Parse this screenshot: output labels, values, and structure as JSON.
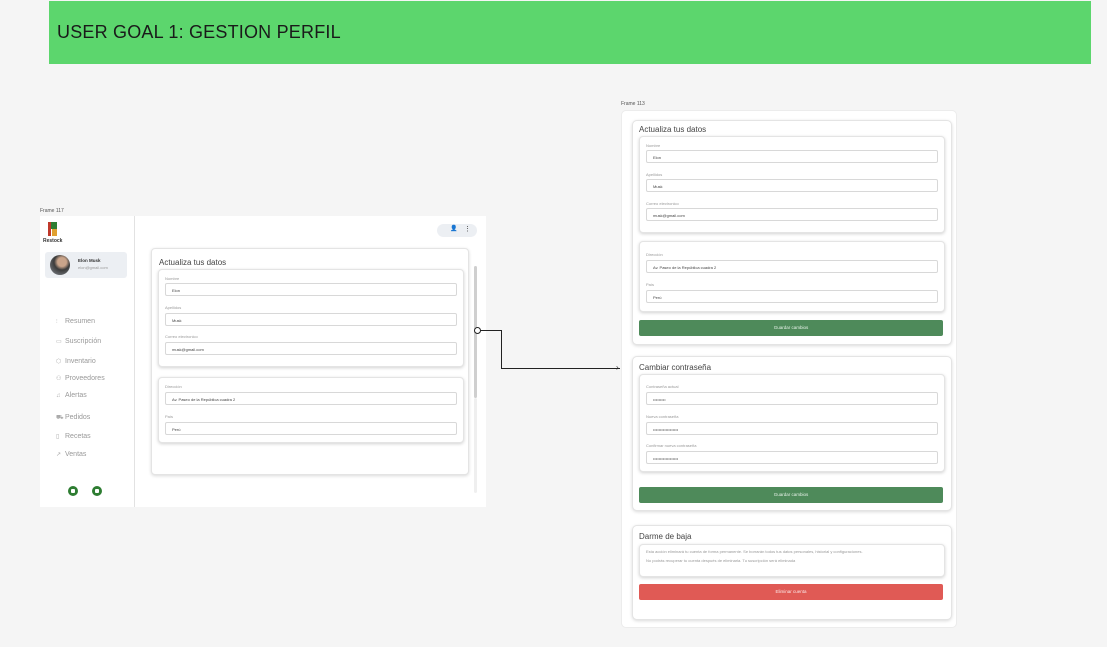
{
  "banner": {
    "title": "USER GOAL 1: GESTION PERFIL"
  },
  "frame_left": {
    "label": "Frame 117",
    "logo_text": "Restock",
    "user": {
      "name": "Elon Musk",
      "email": "elon@gmail.com"
    },
    "nav": [
      {
        "icon": "chart-icon",
        "glyph": "⫶",
        "label": "Resumen"
      },
      {
        "icon": "card-icon",
        "glyph": "▭",
        "label": "Suscripción"
      },
      {
        "icon": "box-icon",
        "glyph": "⬡",
        "label": "Inventario"
      },
      {
        "icon": "people-icon",
        "glyph": "⚇",
        "label": "Proveedores"
      },
      {
        "icon": "bell-icon",
        "glyph": "♫",
        "label": "Alertas"
      },
      {
        "icon": "truck-icon",
        "glyph": "⛟",
        "label": "Pedidos"
      },
      {
        "icon": "recipe-icon",
        "glyph": "▯",
        "label": "Recetas"
      },
      {
        "icon": "trend-icon",
        "glyph": "↗",
        "label": "Ventas"
      }
    ],
    "top_pill": {
      "user_glyph": "👤",
      "menu_glyph": "⋮"
    },
    "panel": {
      "title": "Actualiza tus datos",
      "fields1": [
        {
          "label": "Nombre",
          "value": "Elon"
        },
        {
          "label": "Apellidos",
          "value": "Musk"
        },
        {
          "label": "Correo electronico",
          "value": "musk@gmail.com"
        }
      ],
      "fields2": [
        {
          "label": "Dirección",
          "value": "Av. Paseo de la República cuadra 2"
        },
        {
          "label": "País",
          "value": "Perú"
        }
      ]
    }
  },
  "frame_right": {
    "label": "Frame 113",
    "datos": {
      "title": "Actualiza tus datos",
      "fields1": [
        {
          "label": "Nombre",
          "value": "Elon"
        },
        {
          "label": "Apellidos",
          "value": "Musk"
        },
        {
          "label": "Correo electronico",
          "value": "musk@gmail.com"
        }
      ],
      "fields2": [
        {
          "label": "Dirección",
          "value": "Av. Paseo de la República cuadra 2"
        },
        {
          "label": "País",
          "value": "Perú"
        }
      ],
      "save_label": "Guardar cambios"
    },
    "password": {
      "title": "Cambiar contraseña",
      "fields": [
        {
          "label": "Contraseña actual",
          "value": "•••••••••"
        },
        {
          "label": "Nueva contraseña",
          "value": "••••••••••••••••••"
        },
        {
          "label": "Confirmar nueva contraseña",
          "value": "••••••••••••••••••"
        }
      ],
      "save_label": "Guardar cambios"
    },
    "delete": {
      "title": "Darme de baja",
      "note_line1": "Esta acción eliminará tu cuenta de forma permanente. Se borrarán todos tus datos personales, historial y configuraciones.",
      "note_line2": "No podrás recuperar tu cuenta después de eliminarla. Tu suscripción será eliminada",
      "delete_label": "Eliminar cuenta"
    }
  },
  "colors": {
    "banner": "#5cd66d",
    "save_button": "#4e8a5a",
    "delete_button": "#e05a55"
  }
}
